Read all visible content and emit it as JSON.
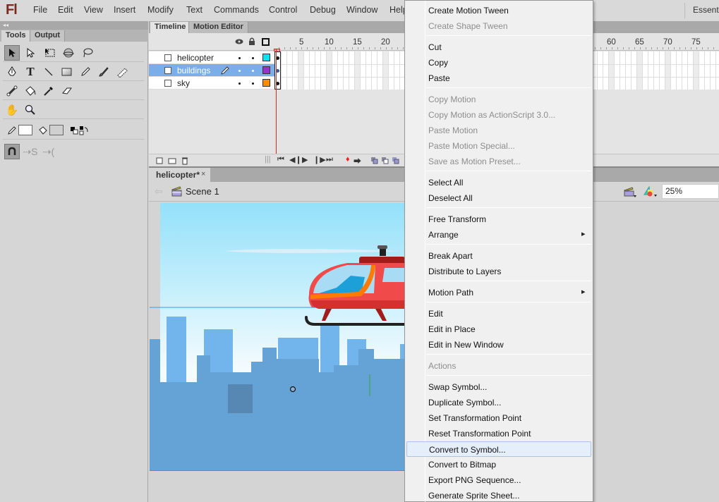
{
  "app": {
    "logo": "Fl",
    "workspace": "Essenti"
  },
  "menubar": {
    "items": [
      "File",
      "Edit",
      "View",
      "Insert",
      "Modify",
      "Text",
      "Commands",
      "Control",
      "Debug",
      "Window",
      "Help"
    ]
  },
  "tools_panel": {
    "collapse_glyph": "◂◂",
    "tabs": [
      {
        "label": "Tools",
        "active": true
      },
      {
        "label": "Output",
        "active": false
      }
    ],
    "tools": {
      "selection": "selection-tool",
      "subselection": "subselection-tool",
      "free_transform": "free-transform-tool",
      "3d_rotation": "3d-rotation-tool",
      "lasso": "lasso-tool",
      "pen": "pen-tool",
      "text": "T",
      "line": "line-tool",
      "rectangle": "rectangle-tool",
      "pencil": "pencil-tool",
      "brush": "brush-tool",
      "deco": "deco-tool",
      "bone": "bone-tool",
      "paint_bucket": "paint-bucket-tool",
      "eyedropper": "eyedropper-tool",
      "eraser": "eraser-tool",
      "hand": "hand-tool",
      "zoom": "zoom-tool"
    },
    "stroke_color": "#ffffff",
    "fill_color": "#d0d0d0"
  },
  "timeline": {
    "tabs": [
      {
        "label": "Timeline",
        "active": true
      },
      {
        "label": "Motion Editor",
        "active": false
      }
    ],
    "current_frame": "1",
    "frame_labels": [
      "5",
      "10",
      "15",
      "20",
      "60",
      "65",
      "70",
      "75"
    ],
    "layers": [
      {
        "name": "helicopter",
        "color": "#00e5ee",
        "selected": false
      },
      {
        "name": "buildings",
        "color": "#9932cc",
        "selected": true
      },
      {
        "name": "sky",
        "color": "#ff8c00",
        "selected": false
      }
    ]
  },
  "document": {
    "tab_label": "helicopter*",
    "close_glyph": "×",
    "scene_label": "Scene 1",
    "zoom_value": "25%"
  },
  "context_menu": {
    "groups": [
      [
        {
          "label": "Create Motion Tween",
          "enabled": true
        },
        {
          "label": "Create Shape Tween",
          "enabled": false
        }
      ],
      [
        {
          "label": "Cut",
          "enabled": true
        },
        {
          "label": "Copy",
          "enabled": true
        },
        {
          "label": "Paste",
          "enabled": true
        }
      ],
      [
        {
          "label": "Copy Motion",
          "enabled": false
        },
        {
          "label": "Copy Motion as ActionScript 3.0...",
          "enabled": false
        },
        {
          "label": "Paste Motion",
          "enabled": false
        },
        {
          "label": "Paste Motion Special...",
          "enabled": false
        },
        {
          "label": "Save as Motion Preset...",
          "enabled": false
        }
      ],
      [
        {
          "label": "Select All",
          "enabled": true
        },
        {
          "label": "Deselect All",
          "enabled": true
        }
      ],
      [
        {
          "label": "Free Transform",
          "enabled": true
        },
        {
          "label": "Arrange",
          "enabled": true,
          "submenu": true
        }
      ],
      [
        {
          "label": "Break Apart",
          "enabled": true
        },
        {
          "label": "Distribute to Layers",
          "enabled": true
        }
      ],
      [
        {
          "label": "Motion Path",
          "enabled": true,
          "submenu": true
        }
      ],
      [
        {
          "label": "Edit",
          "enabled": true
        },
        {
          "label": "Edit in Place",
          "enabled": true
        },
        {
          "label": "Edit in New Window",
          "enabled": true
        }
      ],
      [
        {
          "label": "Actions",
          "enabled": false
        }
      ],
      [
        {
          "label": "Swap Symbol...",
          "enabled": true
        },
        {
          "label": "Duplicate Symbol...",
          "enabled": true
        },
        {
          "label": "Set Transformation Point",
          "enabled": true
        },
        {
          "label": "Reset Transformation Point",
          "enabled": true
        },
        {
          "label": "Convert to Symbol...",
          "enabled": true,
          "highlighted": true
        },
        {
          "label": "Convert to Bitmap",
          "enabled": true
        },
        {
          "label": "Export PNG Sequence...",
          "enabled": true
        },
        {
          "label": "Generate Sprite Sheet...",
          "enabled": true
        }
      ]
    ],
    "submenu_arrow": "▸"
  },
  "colors": {
    "selection_blue": "#79aee8",
    "menu_bg": "#f0f0f0",
    "menu_highlight": "#e5eefb",
    "playhead_red": "#e22222",
    "sky_top": "#93e1fa",
    "buildings_back": "#72b5ec",
    "buildings_front": "#65a2d6",
    "helicopter_body": "#f04a4a"
  }
}
